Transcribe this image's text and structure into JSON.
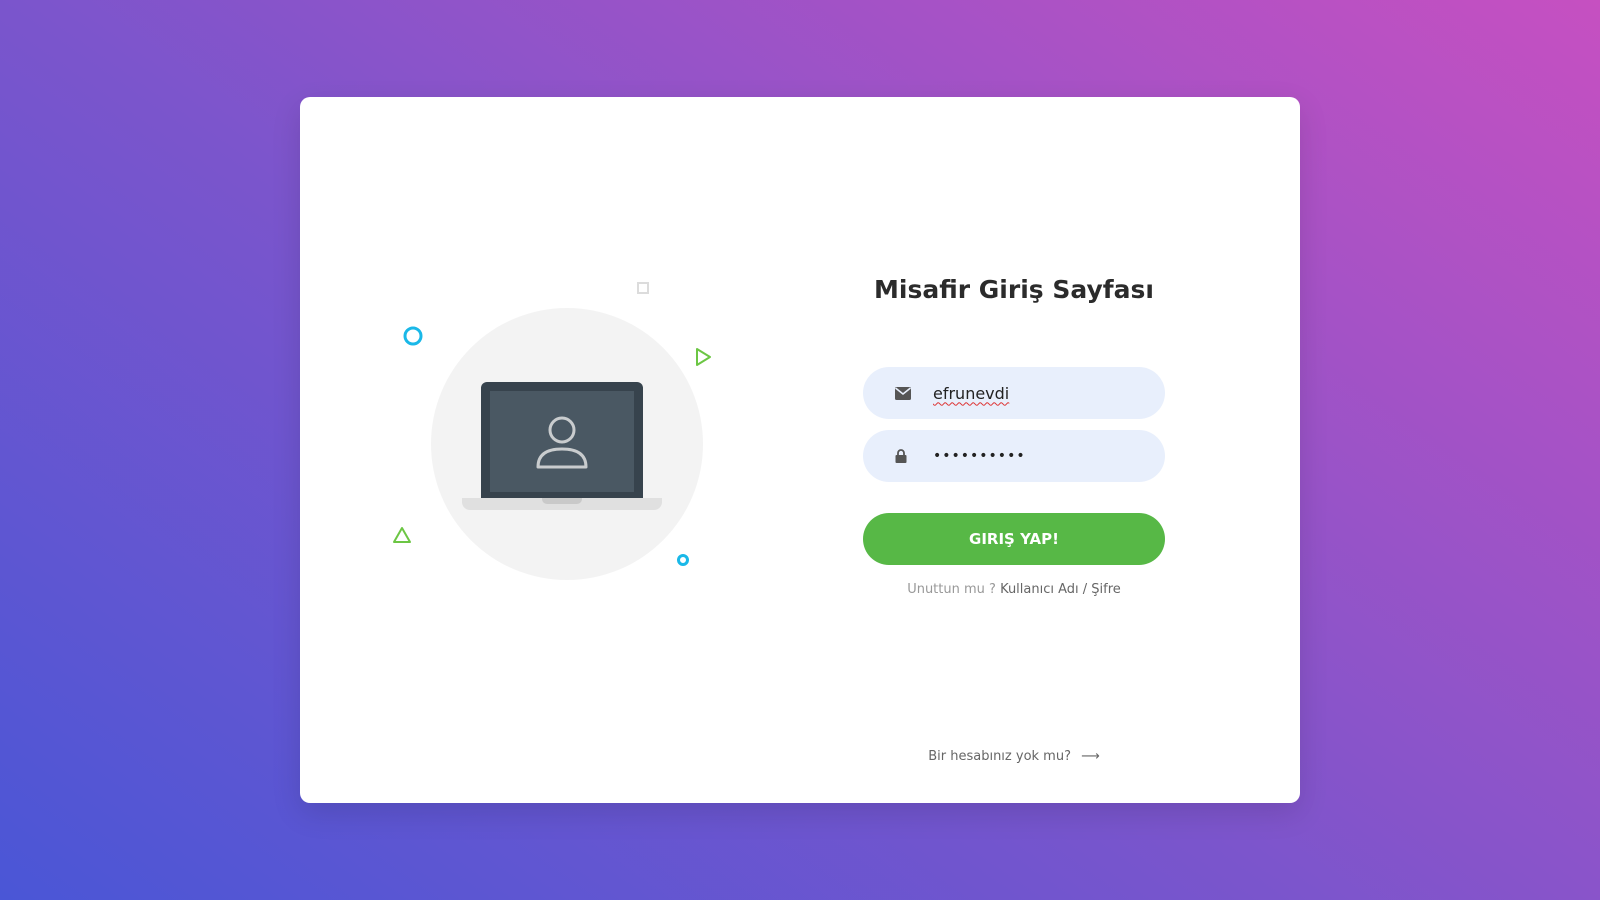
{
  "page": {
    "title": "Misafir Giriş Sayfası"
  },
  "form": {
    "email": {
      "value": "efrunevdi",
      "icon": "envelope-icon"
    },
    "password": {
      "value": "••••••••••",
      "icon": "lock-icon"
    },
    "submit_label": "GIRIŞ YAP!",
    "forgot_prefix": "Unuttun mu ?",
    "forgot_link": "Kullanıcı Adı / Şifre",
    "signup_label": "Bir hesabınız yok mu?",
    "signup_arrow": "⟶"
  },
  "colors": {
    "accent_green": "#57b846",
    "field_bg": "#e8effc",
    "deco_blue": "#1ab8e8",
    "deco_green": "#6cc644"
  },
  "illustration": {
    "icon": "laptop-user-icon"
  }
}
